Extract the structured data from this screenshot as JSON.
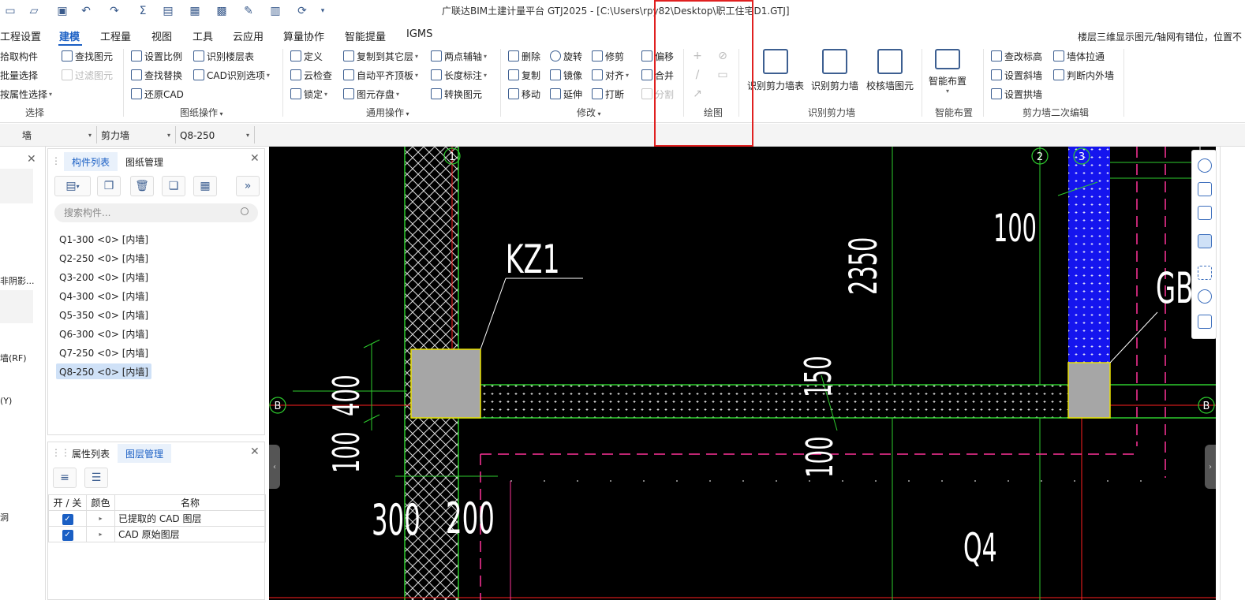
{
  "window": {
    "title": "广联达BIM土建计量平台 GTJ2025 - [C:\\Users\\rpy82\\Desktop\\职工住宅D1.GTJ]"
  },
  "quick_access": [
    "folder-new-icon",
    "folder-open-icon",
    "save-icon",
    "undo-icon",
    "redo-icon",
    "sum-icon",
    "report-icon",
    "table-icon",
    "grid-icon",
    "pen-icon",
    "ruler-icon",
    "sync-icon",
    "more-icon"
  ],
  "menu": {
    "tabs": [
      "工程设置",
      "建模",
      "工程量",
      "视图",
      "工具",
      "云应用",
      "算量协作",
      "智能提量",
      "IGMS"
    ],
    "active": "建模",
    "hint": "楼层三维显示图元/轴网有错位，位置不"
  },
  "ribbon": {
    "select": {
      "items": [
        "拾取构件",
        "批量选择",
        "按属性选择",
        "查找图元",
        "过滤图元"
      ],
      "label": "选择"
    },
    "drawing_ops": {
      "items": [
        "设置比例",
        "识别楼层表",
        "查找替换",
        "CAD识别选项",
        "还原CAD"
      ],
      "label": "图纸操作"
    },
    "common_ops": {
      "items": [
        "定义",
        "复制到其它层",
        "两点辅轴",
        "云检查",
        "自动平齐顶板",
        "长度标注",
        "锁定",
        "图元存盘",
        "转换图元"
      ],
      "label": "通用操作"
    },
    "modify": {
      "items": [
        "删除",
        "旋转",
        "修剪",
        "偏移",
        "复制",
        "镜像",
        "对齐",
        "合并",
        "移动",
        "延伸",
        "打断",
        "分割"
      ],
      "label": "修改"
    },
    "draw": {
      "label": "绘图"
    },
    "recognize_shear_wall": {
      "items": [
        "识别剪力墙表",
        "识别剪力墙",
        "校核墙图元"
      ],
      "label": "识别剪力墙"
    },
    "smart_layout": {
      "items": [
        "智能布置"
      ],
      "label": "智能布置"
    },
    "shear_wall_edit": {
      "items": [
        "查改标高",
        "墙体拉通",
        "设置斜墙",
        "判断内外墙",
        "设置拱墙"
      ],
      "label": "剪力墙二次编辑"
    }
  },
  "selector": {
    "category": "墙",
    "type": "剪力墙",
    "component": "Q8-250"
  },
  "left_strip": {
    "items": [
      "非阴影...",
      "墙(RF)",
      "(Y)",
      "洞"
    ]
  },
  "component_panel": {
    "tabs": [
      "构件列表",
      "图纸管理"
    ],
    "active_tab": "构件列表",
    "search_placeholder": "搜索构件...",
    "items": [
      "Q1-300 <0> [内墙]",
      "Q2-250 <0> [内墙]",
      "Q3-200 <0> [内墙]",
      "Q4-300 <0> [内墙]",
      "Q5-350 <0> [内墙]",
      "Q6-300 <0> [内墙]",
      "Q7-250 <0> [内墙]",
      "Q8-250 <0> [内墙]"
    ],
    "selected": "Q8-250 <0> [内墙]"
  },
  "layer_panel": {
    "tabs": [
      "属性列表",
      "图层管理"
    ],
    "active_tab": "图层管理",
    "columns": [
      "开 / 关",
      "颜色",
      "名称"
    ],
    "rows": [
      {
        "checked": true,
        "name": "已提取的 CAD 图层"
      },
      {
        "checked": true,
        "name": "CAD 原始图层"
      }
    ]
  },
  "canvas": {
    "labels": {
      "kz1": "KZ1",
      "dim_2350": "2350",
      "dim_100_top": "100",
      "dim_150": "150",
      "dim_400": "400",
      "dim_100_left": "100",
      "dim_300": "300",
      "dim_200": "200",
      "dim_100_mid": "100",
      "gb": "GB",
      "q4": "Q4"
    },
    "axes": {
      "axis_1": "1",
      "axis_2": "2",
      "axis_3": "3",
      "axis_b_left": "B",
      "axis_b_right": "B"
    }
  }
}
